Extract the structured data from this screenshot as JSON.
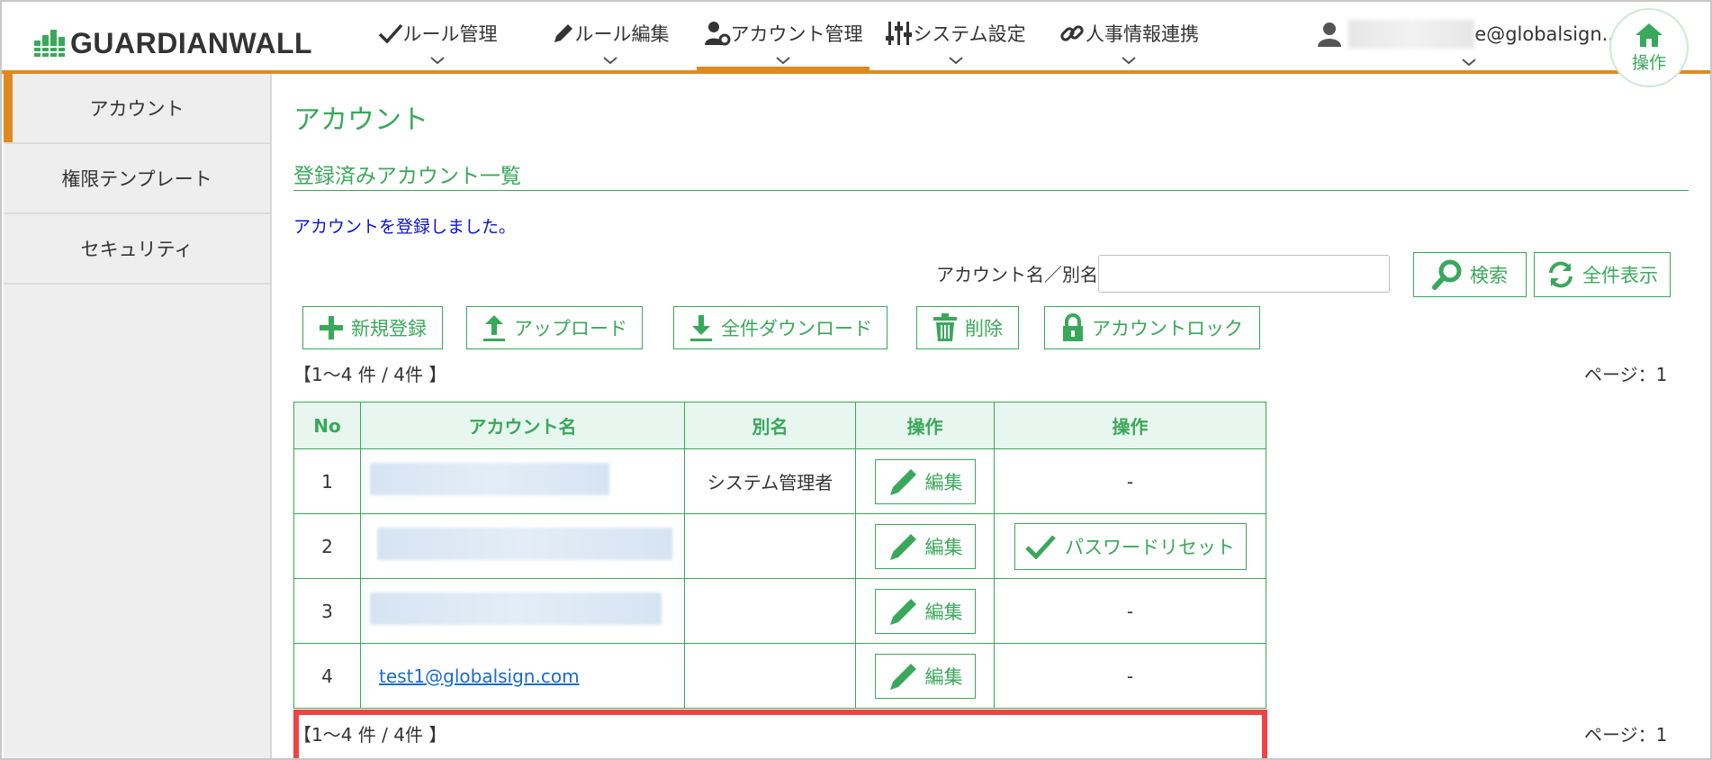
{
  "app": {
    "logo_text": "GUARDIANWALL"
  },
  "nav": [
    {
      "label": "ルール管理",
      "icon": "check-icon"
    },
    {
      "label": "ルール編集",
      "icon": "pencil-icon"
    },
    {
      "label": "アカウント管理",
      "icon": "user-gear-icon",
      "active": true
    },
    {
      "label": "システム設定",
      "icon": "sliders-icon"
    },
    {
      "label": "人事情報連携",
      "icon": "link-icon"
    }
  ],
  "user": {
    "email_suffix": "e@globalsign..."
  },
  "home": {
    "label": "操作"
  },
  "sidebar": {
    "items": [
      {
        "label": "アカウント",
        "active": true
      },
      {
        "label": "権限テンプレート"
      },
      {
        "label": "セキュリティ"
      }
    ]
  },
  "page": {
    "title": "アカウント",
    "section_title": "登録済みアカウント一覧",
    "message": "アカウントを登録しました。"
  },
  "search": {
    "label": "アカウント名／別名",
    "value": "",
    "placeholder": "",
    "search_button": "検索",
    "show_all_button": "全件表示"
  },
  "toolbar": {
    "new": "新規登録",
    "upload": "アップロード",
    "download_all": "全件ダウンロード",
    "delete": "削除",
    "lock": "アカウントロック"
  },
  "pagination": {
    "count_text": "【1～4 件 / 4件 】",
    "page_text": "ページ：1"
  },
  "table": {
    "headers": [
      "No",
      "アカウント名",
      "別名",
      "操作",
      "操作"
    ],
    "edit_label": "編集",
    "password_reset_label": "パスワードリセット",
    "rows": [
      {
        "no": "1",
        "account": "",
        "alias": "システム管理者",
        "op2": "-"
      },
      {
        "no": "2",
        "account": "",
        "alias": "",
        "op2": "パスワードリセット"
      },
      {
        "no": "3",
        "account": "",
        "alias": "",
        "op2": "-"
      },
      {
        "no": "4",
        "account": "test1@globalsign.com",
        "alias": "",
        "op2": "-"
      }
    ]
  },
  "colors": {
    "accent_green": "#3aa85a",
    "nav_orange": "#e08a1e",
    "highlight_red": "#ef4444",
    "message_blue": "#0a14d6",
    "link_blue": "#1a6bc9"
  }
}
